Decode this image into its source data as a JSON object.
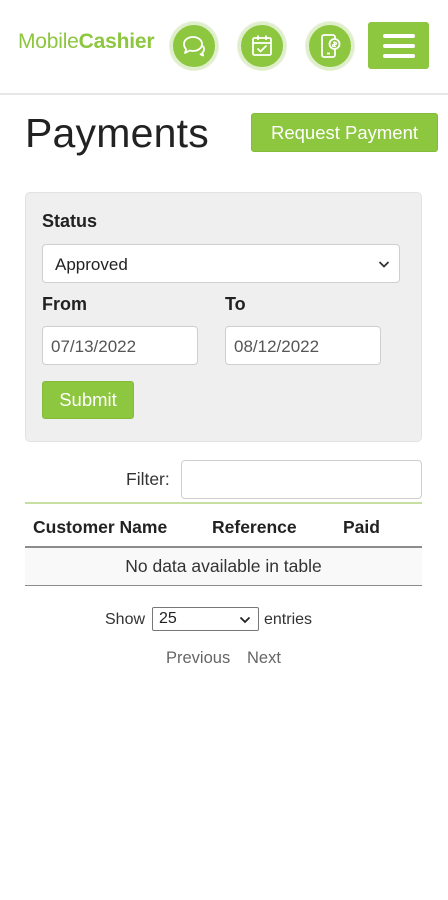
{
  "header": {
    "logo_prefix": "Mobile",
    "logo_suffix": "Cashier",
    "icons": [
      "chat-icon",
      "calendar-check-icon",
      "mobile-payment-icon",
      "menu-icon"
    ],
    "accent_color": "#8dc63f"
  },
  "page": {
    "title": "Payments",
    "request_button": "Request Payment"
  },
  "filters": {
    "status_label": "Status",
    "status_value": "Approved",
    "from_label": "From",
    "from_value": "07/13/2022",
    "to_label": "To",
    "to_value": "08/12/2022",
    "submit_label": "Submit"
  },
  "table": {
    "filter_label": "Filter:",
    "filter_value": "",
    "columns": [
      "Customer Name",
      "Reference",
      "Paid"
    ],
    "empty_message": "No data available in table",
    "show_label": "Show",
    "page_size": "25",
    "entries_label": "entries",
    "previous_label": "Previous",
    "next_label": "Next"
  }
}
